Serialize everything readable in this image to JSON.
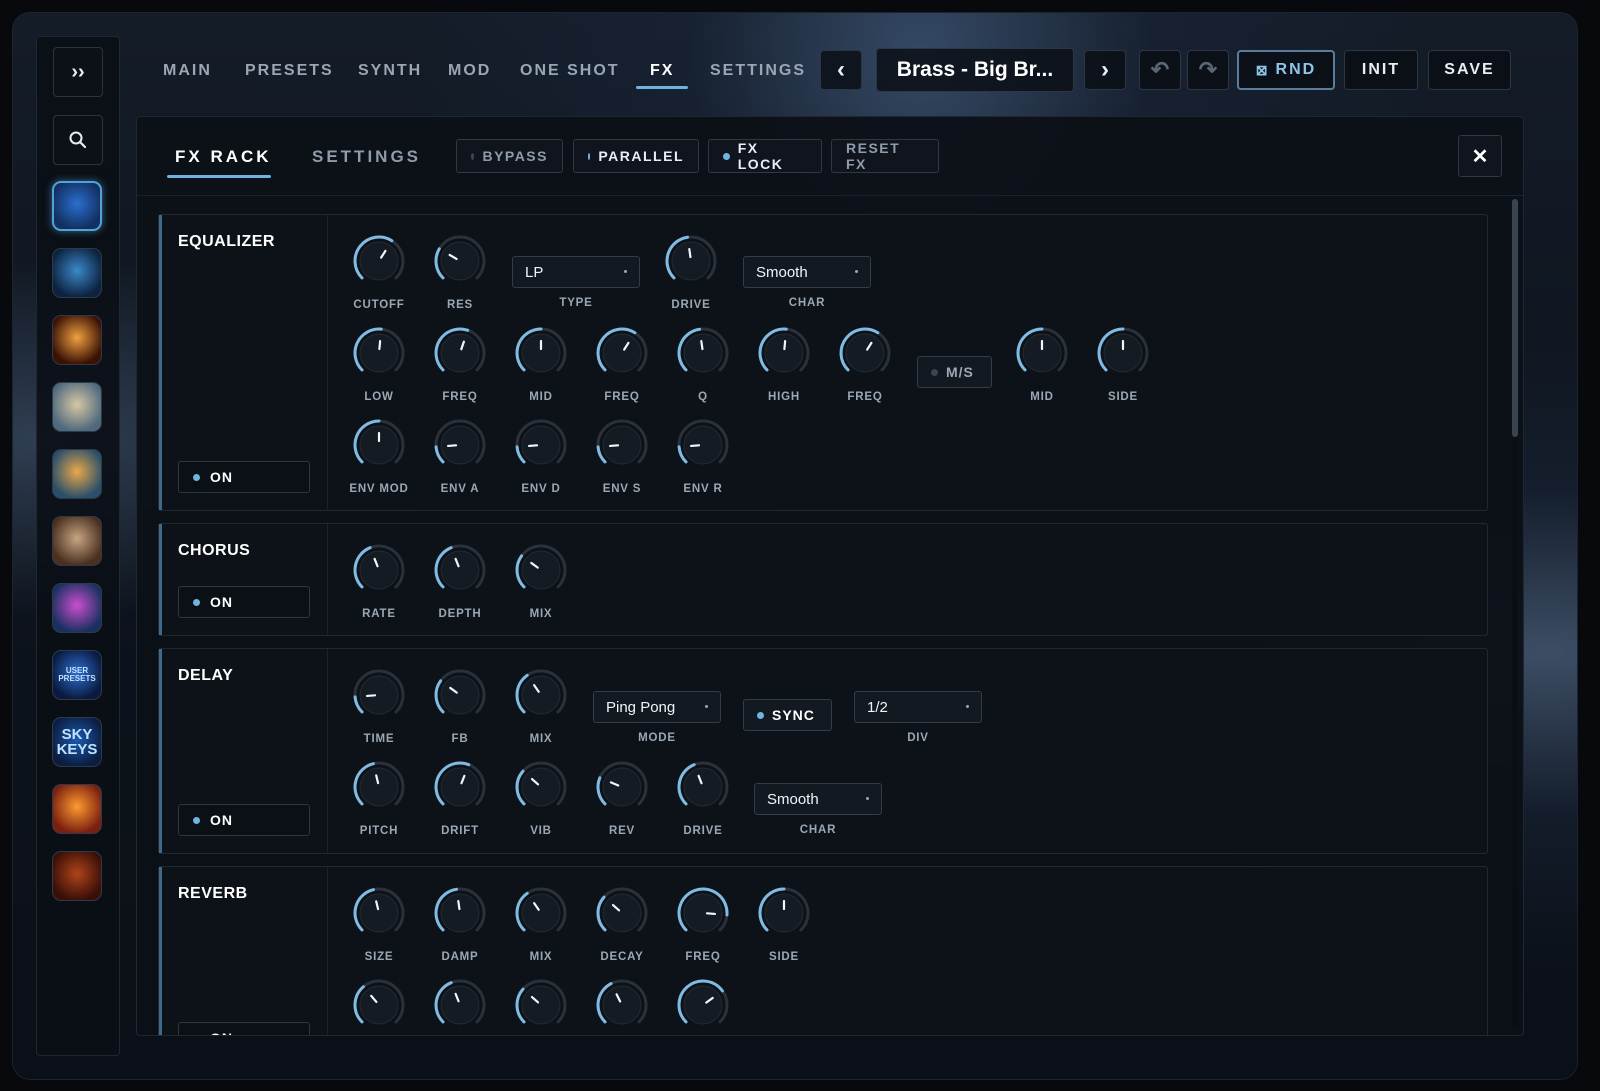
{
  "sidebar": {
    "expand_label": "››",
    "search_icon": "search-icon",
    "thumbs": [
      {
        "name": "preset-pack-1",
        "c1": "#2a6fd0",
        "c2": "#123060",
        "active": true
      },
      {
        "name": "preset-pack-2",
        "c1": "#3a89c9",
        "c2": "#0d2240",
        "active": false
      },
      {
        "name": "preset-pack-3",
        "c1": "#f0a040",
        "c2": "#3a1205",
        "active": false
      },
      {
        "name": "preset-pack-4",
        "c1": "#d7c7a3",
        "c2": "#4f6a7e",
        "active": false
      },
      {
        "name": "preset-pack-5",
        "c1": "#e8a84a",
        "c2": "#2a4f6a",
        "active": false
      },
      {
        "name": "preset-pack-6",
        "c1": "#c7a582",
        "c2": "#4a3020",
        "active": false
      },
      {
        "name": "preset-pack-7",
        "c1": "#c94fd0",
        "c2": "#1a3060",
        "active": false
      },
      {
        "name": "preset-pack-user",
        "c1": "#2e6fd0",
        "c2": "#0a1a40",
        "active": false
      },
      {
        "name": "preset-pack-sky-keys",
        "c1": "#1b5ab0",
        "c2": "#0c1d40",
        "active": false
      },
      {
        "name": "preset-pack-10",
        "c1": "#ff9a30",
        "c2": "#7a2010",
        "active": false
      },
      {
        "name": "preset-pack-11",
        "c1": "#b0441a",
        "c2": "#3a0f08",
        "active": false
      }
    ],
    "user_presets_text": "USER PRESETS",
    "sky_keys_text": "SKY KEYS"
  },
  "nav": {
    "items": [
      "MAIN",
      "PRESETS",
      "SYNTH",
      "MOD",
      "ONE SHOT",
      "FX",
      "SETTINGS"
    ],
    "active": "FX"
  },
  "header": {
    "prev_label": "‹",
    "preset_name": "Brass - Big Br...",
    "next_label": "›",
    "undo_label": "↶",
    "redo_label": "↷",
    "rnd_label": "RND",
    "rnd_icon": "⊠",
    "init_label": "INIT",
    "save_label": "SAVE"
  },
  "fx_panel": {
    "tabs": [
      "FX RACK",
      "SETTINGS"
    ],
    "active_tab": "FX RACK",
    "bypass_label": "BYPASS",
    "parallel_label": "PARALLEL",
    "fx_lock_label": "FX LOCK",
    "reset_label": "RESET FX",
    "close_label": "✕"
  },
  "equalizer": {
    "title": "EQUALIZER",
    "on_label": "ON",
    "row1": [
      {
        "label": "CUTOFF",
        "value": 0.62
      },
      {
        "label": "RES",
        "value": 0.28
      }
    ],
    "type_value": "LP",
    "type_label": "TYPE",
    "drive": {
      "label": "DRIVE",
      "value": 0.47
    },
    "char_value": "Smooth",
    "char_label": "CHAR",
    "row2": [
      {
        "label": "LOW",
        "value": 0.52
      },
      {
        "label": "FREQ",
        "value": 0.57
      },
      {
        "label": "MID",
        "value": 0.5
      },
      {
        "label": "FREQ",
        "value": 0.62
      },
      {
        "label": "Q",
        "value": 0.47
      },
      {
        "label": "HIGH",
        "value": 0.52
      },
      {
        "label": "FREQ",
        "value": 0.62
      }
    ],
    "ms_label": "M/S",
    "ms_knobs": [
      {
        "label": "MID",
        "value": 0.5
      },
      {
        "label": "SIDE",
        "value": 0.5
      }
    ],
    "row3": [
      {
        "label": "ENV MOD",
        "value": 0.5
      },
      {
        "label": "ENV A",
        "value": 0.15
      },
      {
        "label": "ENV D",
        "value": 0.15
      },
      {
        "label": "ENV S",
        "value": 0.15
      },
      {
        "label": "ENV R",
        "value": 0.15
      }
    ]
  },
  "chorus": {
    "title": "CHORUS",
    "on_label": "ON",
    "knobs": [
      {
        "label": "RATE",
        "value": 0.42
      },
      {
        "label": "DEPTH",
        "value": 0.42
      },
      {
        "label": "MIX",
        "value": 0.3
      }
    ]
  },
  "delay": {
    "title": "DELAY",
    "on_label": "ON",
    "row1": [
      {
        "label": "TIME",
        "value": 0.15
      },
      {
        "label": "FB",
        "value": 0.3
      },
      {
        "label": "MIX",
        "value": 0.37
      }
    ],
    "mode_value": "Ping Pong",
    "mode_label": "MODE",
    "sync_label": "SYNC",
    "div_value": "1/2",
    "div_label": "DIV",
    "row2": [
      {
        "label": "PITCH",
        "value": 0.45
      },
      {
        "label": "DRIFT",
        "value": 0.58
      },
      {
        "label": "VIB",
        "value": 0.32
      },
      {
        "label": "REV",
        "value": 0.25
      },
      {
        "label": "DRIVE",
        "value": 0.42
      }
    ],
    "char_value": "Smooth",
    "char_label": "CHAR"
  },
  "reverb": {
    "title": "REVERB",
    "on_label": "ON",
    "row1": [
      {
        "label": "SIZE",
        "value": 0.45
      },
      {
        "label": "DAMP",
        "value": 0.47
      },
      {
        "label": "MIX",
        "value": 0.37
      },
      {
        "label": "DECAY",
        "value": 0.32
      },
      {
        "label": "FREQ",
        "value": 0.85
      },
      {
        "label": "SIDE",
        "value": 0.5
      }
    ],
    "row2": [
      0.35,
      0.42,
      0.32,
      0.4,
      0.7
    ]
  },
  "colors": {
    "accent": "#6fb4e0",
    "knob_arc": "#7fbbe2",
    "knob_track": "#2a313b"
  }
}
